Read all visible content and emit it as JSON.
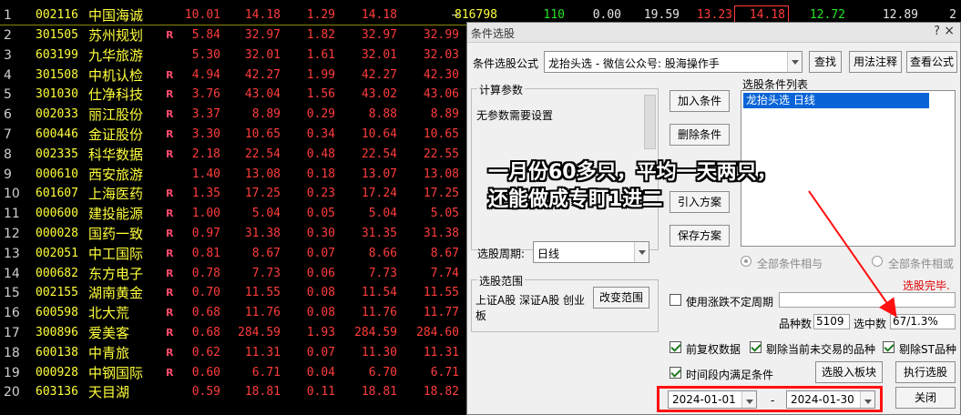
{
  "table": {
    "first_row": {
      "index": "1",
      "code": "002116",
      "name": "中国海诚",
      "values": [
        "10.01",
        "14.18",
        "1.29",
        "14.18",
        "—"
      ],
      "extra": [
        {
          "text": "816798",
          "color": "#ffff3c"
        },
        {
          "text": "110",
          "color": "#26e626"
        },
        {
          "text": "0.00",
          "color": "#e6e6e6"
        },
        {
          "text": "19.59",
          "color": "#e6e6e6"
        },
        {
          "text": "13.23",
          "color": "#ff3c3c"
        },
        {
          "text": "14.18",
          "color": "#ff3c3c"
        },
        {
          "text": "12.72",
          "color": "#26e626"
        },
        {
          "text": "12.89",
          "color": "#e6e6e6"
        },
        {
          "text": "2",
          "color": "#e6e6e6"
        }
      ]
    },
    "rows": [
      {
        "index": "2",
        "code": "301505",
        "name": "苏州规划",
        "flag": "R",
        "pct": "5.84",
        "price": "32.97",
        "chg": "1.82",
        "buy": "32.97",
        "sell": "32.99"
      },
      {
        "index": "3",
        "code": "603199",
        "name": "九华旅游",
        "flag": "",
        "pct": "5.30",
        "price": "32.01",
        "chg": "1.61",
        "buy": "32.01",
        "sell": "32.03"
      },
      {
        "index": "4",
        "code": "301508",
        "name": "中机认检",
        "flag": "R",
        "pct": "4.94",
        "price": "42.27",
        "chg": "1.99",
        "buy": "42.27",
        "sell": "42.30"
      },
      {
        "index": "5",
        "code": "301030",
        "name": "仕净科技",
        "flag": "R",
        "pct": "3.76",
        "price": "43.04",
        "chg": "1.56",
        "buy": "43.02",
        "sell": "43.06"
      },
      {
        "index": "6",
        "code": "002033",
        "name": "丽江股份",
        "flag": "R",
        "pct": "3.37",
        "price": "8.89",
        "chg": "0.29",
        "buy": "8.88",
        "sell": "8.89"
      },
      {
        "index": "7",
        "code": "600446",
        "name": "金证股份",
        "flag": "R",
        "pct": "3.30",
        "price": "10.65",
        "chg": "0.34",
        "buy": "10.64",
        "sell": "10.65"
      },
      {
        "index": "8",
        "code": "002335",
        "name": "科华数据",
        "flag": "R",
        "pct": "2.18",
        "price": "22.54",
        "chg": "0.48",
        "buy": "22.54",
        "sell": "22.55"
      },
      {
        "index": "9",
        "code": "000610",
        "name": "西安旅游",
        "flag": "",
        "pct": "1.40",
        "price": "13.08",
        "chg": "0.18",
        "buy": "13.07",
        "sell": "13.08"
      },
      {
        "index": "10",
        "code": "601607",
        "name": "上海医药",
        "flag": "R",
        "pct": "1.35",
        "price": "17.25",
        "chg": "0.23",
        "buy": "17.24",
        "sell": "17.25"
      },
      {
        "index": "11",
        "code": "000600",
        "name": "建投能源",
        "flag": "R",
        "pct": "1.00",
        "price": "5.04",
        "chg": "0.05",
        "buy": "5.04",
        "sell": "5.05"
      },
      {
        "index": "12",
        "code": "000028",
        "name": "国药一致",
        "flag": "R",
        "pct": "0.97",
        "price": "31.38",
        "chg": "0.30",
        "buy": "31.35",
        "sell": "31.38"
      },
      {
        "index": "13",
        "code": "002051",
        "name": "中工国际",
        "flag": "R",
        "pct": "0.81",
        "price": "8.67",
        "chg": "0.07",
        "buy": "8.66",
        "sell": "8.67"
      },
      {
        "index": "14",
        "code": "000682",
        "name": "东方电子",
        "flag": "R",
        "pct": "0.78",
        "price": "7.73",
        "chg": "0.06",
        "buy": "7.73",
        "sell": "7.74"
      },
      {
        "index": "15",
        "code": "002155",
        "name": "湖南黄金",
        "flag": "R",
        "pct": "0.70",
        "price": "11.55",
        "chg": "0.08",
        "buy": "11.54",
        "sell": "11.55"
      },
      {
        "index": "16",
        "code": "600598",
        "name": "北大荒",
        "flag": "R",
        "pct": "0.68",
        "price": "11.76",
        "chg": "0.08",
        "buy": "11.76",
        "sell": "11.77"
      },
      {
        "index": "17",
        "code": "300896",
        "name": "爱美客",
        "flag": "R",
        "pct": "0.68",
        "price": "284.59",
        "chg": "1.93",
        "buy": "284.59",
        "sell": "284.60"
      },
      {
        "index": "18",
        "code": "600138",
        "name": "中青旅",
        "flag": "R",
        "pct": "0.62",
        "price": "11.31",
        "chg": "0.07",
        "buy": "11.30",
        "sell": "11.31"
      },
      {
        "index": "19",
        "code": "000928",
        "name": "中钢国际",
        "flag": "R",
        "pct": "0.60",
        "price": "6.71",
        "chg": "0.04",
        "buy": "6.70",
        "sell": "6.71"
      },
      {
        "index": "20",
        "code": "603136",
        "name": "天目湖",
        "flag": "",
        "pct": "0.59",
        "price": "18.81",
        "chg": "0.11",
        "buy": "18.81",
        "sell": "18.82"
      }
    ]
  },
  "dialog": {
    "title": "条件选股",
    "help": "?",
    "close": "×",
    "formula_label": "条件选股公式",
    "formula_value": "龙抬头选   - 微信公众号: 股海操作手",
    "btn_find": "查找",
    "btn_usage": "用法注释",
    "btn_view": "查看公式",
    "params_group": "计算参数",
    "params_text": "无参数需要设置",
    "btn_add": "加入条件",
    "btn_delete": "删除条件",
    "btn_load": "引入方案",
    "btn_save": "保存方案",
    "list_label": "选股条件列表",
    "list_items": [
      "龙抬头选  日线"
    ],
    "period_label": "选股周期:",
    "period_value": "日线",
    "radio_and": "全部条件相与",
    "radio_or": "全部条件相或",
    "status": "选股完毕.",
    "scope_group": "选股范围",
    "scope_text": "上证A股 深证A股 创业板",
    "btn_scope": "改变范围",
    "chk_unsure": "使用涨跌不定周期",
    "count_label": "品种数",
    "count_value": "5109",
    "selected_label": "选中数",
    "selected_value": "67/1.3%",
    "chk_adjust": "前复权数据",
    "chk_no_trade": "剔除当前未交易的品种",
    "chk_st": "剔除ST品种",
    "chk_period": "时间段内满足条件",
    "btn_to_block": "选股入板块",
    "btn_run": "执行选股",
    "date_from": "2024-01-01",
    "date_sep": "-",
    "date_to": "2024-01-30",
    "btn_close": "关闭"
  },
  "annotation": {
    "line1": "一月份60多只，平均一天两只，",
    "line2": "还能做成专盯1进二"
  },
  "colors": {
    "up_red": "#ff3c3c",
    "code_yellow": "#ffff3c",
    "list_select": "#0a64d8",
    "highlight_box": "#ff1010"
  }
}
